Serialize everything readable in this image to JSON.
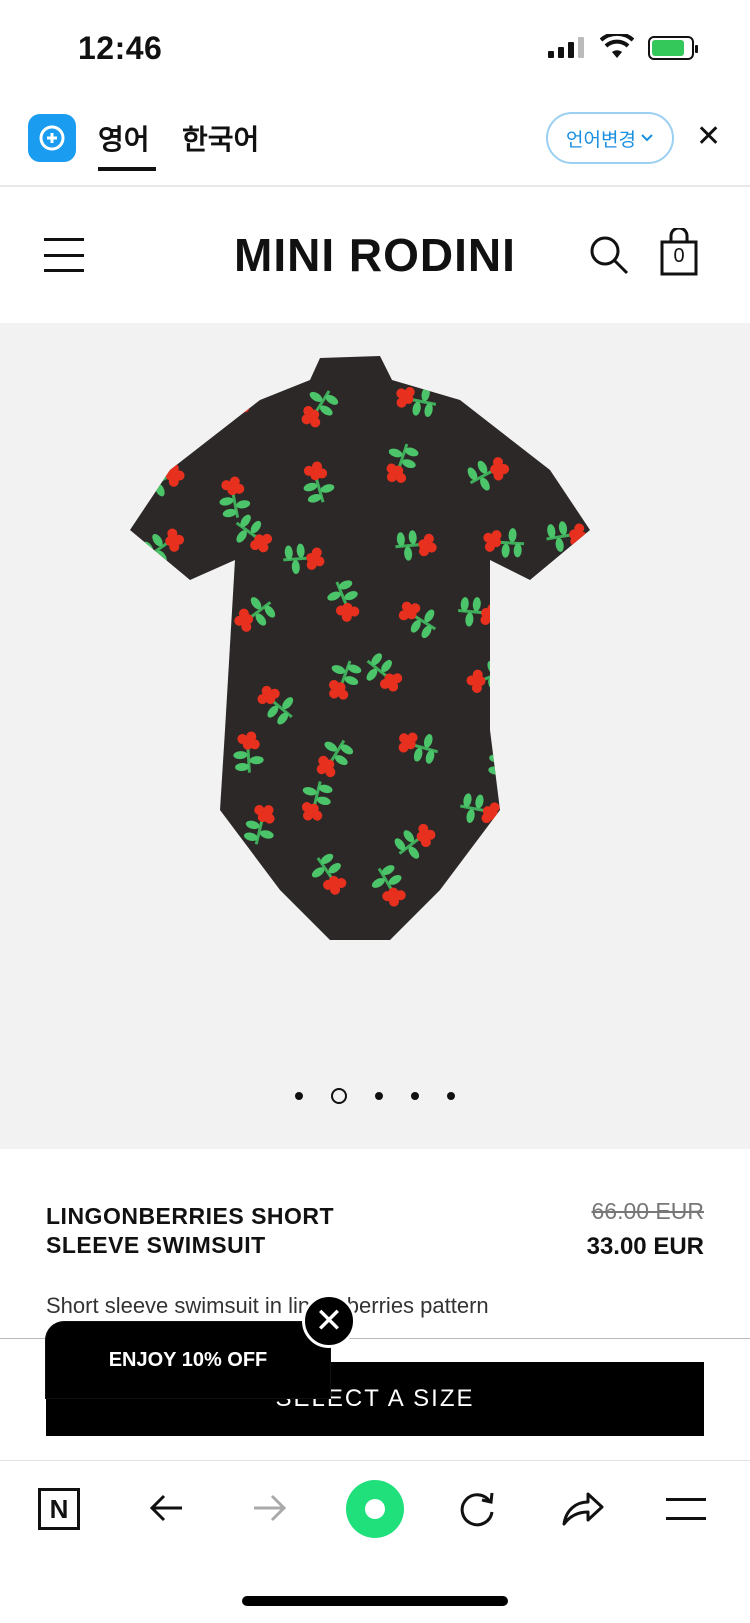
{
  "status_bar": {
    "time": "12:46"
  },
  "translate_bar": {
    "tab_english": "영어",
    "tab_korean": "한국어",
    "change_language": "언어변경",
    "close": "✕"
  },
  "site_header": {
    "brand": "MINI RODINI",
    "cart_count": "0"
  },
  "gallery": {
    "dots": 5,
    "active_dot": 2
  },
  "product": {
    "title": "LINGONBERRIES SHORT SLEEVE SWIMSUIT",
    "old_price": "66.00 EUR",
    "new_price": "33.00 EUR",
    "description": "Short sleeve swimsuit in lingonberries pattern",
    "size_button": "SELECT A SIZE"
  },
  "promo": {
    "text": "ENJOY 10% OFF",
    "close": "✕"
  },
  "bottom_nav": {
    "naver_label": "N"
  }
}
